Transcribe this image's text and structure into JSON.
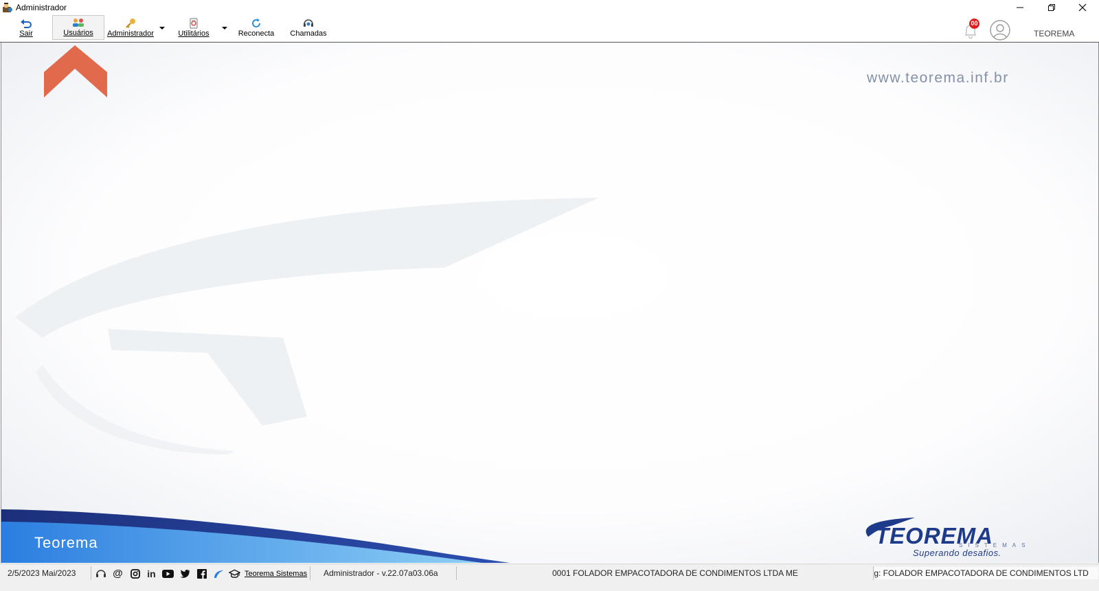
{
  "window": {
    "title": "Administrador"
  },
  "toolbar": {
    "buttons": [
      {
        "label": "Sair",
        "icon": "exit-icon"
      },
      {
        "label": "Usuários",
        "icon": "users-icon"
      },
      {
        "label": "Administrador",
        "icon": "key-icon"
      },
      {
        "label": "Utilitários",
        "icon": "utilities-icon"
      },
      {
        "label": "Reconecta",
        "icon": "reconnect-icon"
      },
      {
        "label": "Chamadas",
        "icon": "support-calls-icon"
      }
    ],
    "notification_count": "00",
    "user_name": "TEOREMA"
  },
  "main": {
    "website": "www.teorema.inf.br",
    "bottom_brand": "Teorema",
    "logo_name": "TEOREMA",
    "logo_sub": "SISTEMAS",
    "logo_slogan": "Superando desafios."
  },
  "status": {
    "date": "2/5/2023 Mai/2023",
    "social_icons": [
      "support-icon",
      "email-icon",
      "instagram-icon",
      "linkedin-icon",
      "youtube-icon",
      "twitter-icon",
      "facebook-icon",
      "teorema-swoosh-icon",
      "graduation-cap-icon"
    ],
    "company_link": "Teorema Sistemas",
    "version": "Administrador - v.22.07a03.06a",
    "company": "0001 FOLADOR EMPACOTADORA DE CONDIMENTOS LTDA ME",
    "scrolling_company": ":g: FOLADOR EMPACOTADORA DE CONDIMENTOS LTD"
  },
  "colors": {
    "accent_orange": "#E06A4B",
    "brand_blue": "#1E3A8A",
    "badge_red": "#E02020"
  }
}
